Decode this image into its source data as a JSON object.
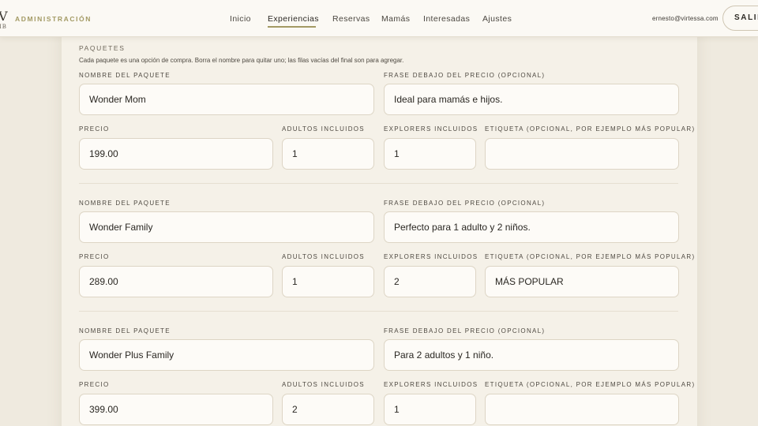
{
  "header": {
    "logo_letter": "V",
    "logo_sub": "IB",
    "brand": "ADMINISTRACIÓN",
    "nav": [
      {
        "label": "Inicio",
        "active": false
      },
      {
        "label": "Experiencias",
        "active": true
      },
      {
        "label": "Reservas",
        "active": false
      },
      {
        "label": "Mamás",
        "active": false
      },
      {
        "label": "Interesadas",
        "active": false
      },
      {
        "label": "Ajustes",
        "active": false
      }
    ],
    "user_email": "ernesto@virtessa.com",
    "logout_label": "SALIR"
  },
  "packages_section": {
    "title": "PAQUETES",
    "description": "Cada paquete es una opción de compra. Borra el nombre para quitar uno; las filas vacías del final son para agregar.",
    "labels": {
      "name": "NOMBRE DEL PAQUETE",
      "phrase": "FRASE DEBAJO DEL PRECIO (OPCIONAL)",
      "price": "PRECIO",
      "adults": "ADULTOS INCLUIDOS",
      "explorers": "EXPLORERS INCLUIDOS",
      "tag": "ETIQUETA (OPCIONAL, POR EJEMPLO MÁS POPULAR)"
    },
    "packages": [
      {
        "name": "Wonder Mom",
        "phrase": "Ideal para mamás e hijos.",
        "price": "199.00",
        "adults": "1",
        "explorers": "1",
        "tag": ""
      },
      {
        "name": "Wonder Family",
        "phrase": "Perfecto para 1 adulto y 2 niños.",
        "price": "289.00",
        "adults": "1",
        "explorers": "2",
        "tag": "MÁS POPULAR"
      },
      {
        "name": "Wonder Plus Family",
        "phrase": "Para 2 adultos y 1 niño.",
        "price": "399.00",
        "adults": "2",
        "explorers": "1",
        "tag": ""
      }
    ]
  }
}
